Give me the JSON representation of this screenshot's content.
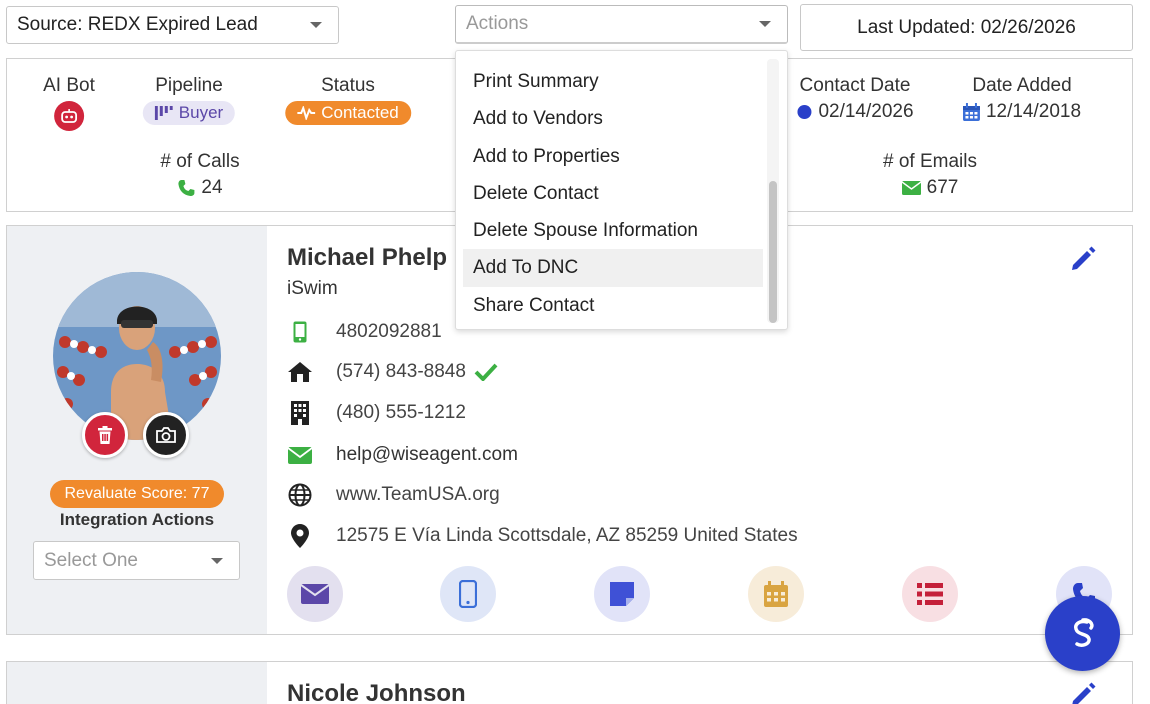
{
  "top_bar": {
    "source_value": "Source: REDX Expired Lead",
    "actions_placeholder": "Actions",
    "last_updated": "Last Updated: 02/26/2026"
  },
  "stats": {
    "ai_bot_label": "AI Bot",
    "pipeline_label": "Pipeline",
    "pipeline_value": "Buyer",
    "status_label": "Status",
    "status_value": "Contacted",
    "contact_date_label": "Contact Date",
    "contact_date_value": "02/14/2026",
    "date_added_label": "Date Added",
    "date_added_value": "12/14/2018",
    "calls_label": "# of Calls",
    "calls_value": "24",
    "emails_label": "# of Emails",
    "emails_value": "677"
  },
  "actions_menu": {
    "items": [
      "Print Summary",
      "Add to Vendors",
      "Add to Properties",
      "Delete Contact",
      "Delete Spouse Information",
      "Add To DNC",
      "Share Contact"
    ],
    "hovered_index": 5
  },
  "contact": {
    "name": "Michael Phelp",
    "company": "iSwim",
    "mobile": "4802092881",
    "home": "(574) 843-8848",
    "work": "(480) 555-1212",
    "email": "help@wiseagent.com",
    "website": "www.TeamUSA.org",
    "address": "12575 E Vía Linda Scottsdale, AZ 85259 United States",
    "score_label": "Revaluate Score: 77",
    "integration_label": "Integration Actions",
    "integration_placeholder": "Select One"
  },
  "next_contact": {
    "name": "Nicole Johnson"
  },
  "colors": {
    "accent_orange": "#f08a2c",
    "brand_blue": "#2a40c9",
    "danger_red": "#d1253c",
    "success_green": "#3cb043",
    "purple": "#5b47a8"
  },
  "icons": {
    "ai_bot": "robot-icon",
    "pipeline": "bars-icon",
    "status": "pulse-icon",
    "contact_date": "clock-icon",
    "date_added": "calendar-icon",
    "calls": "phone-icon",
    "emails": "envelope-icon"
  }
}
